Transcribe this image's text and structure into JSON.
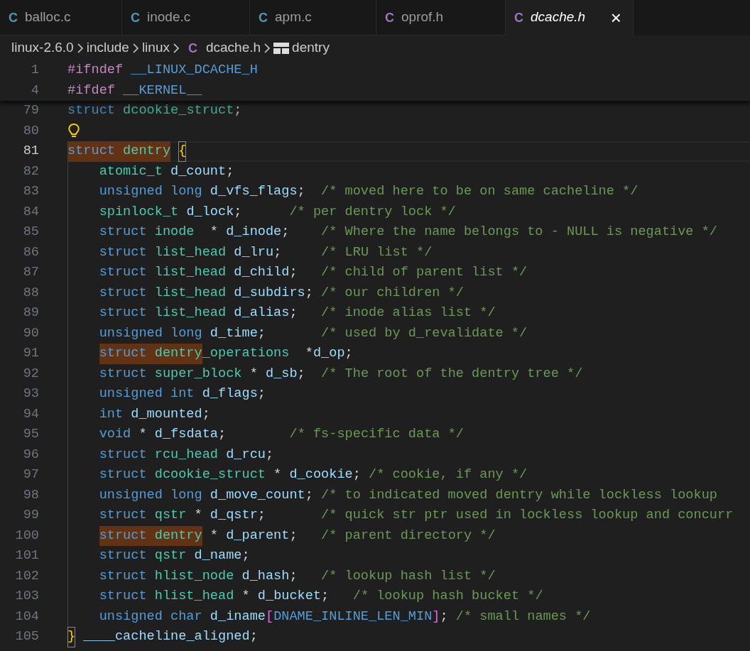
{
  "tabs": [
    {
      "icon": "C",
      "label": "balloc.c",
      "color": "#519aba",
      "selected": false,
      "preview": false
    },
    {
      "icon": "C",
      "label": "inode.c",
      "color": "#519aba",
      "selected": false,
      "preview": false
    },
    {
      "icon": "C",
      "label": "apm.c",
      "color": "#519aba",
      "selected": false,
      "preview": false
    },
    {
      "icon": "C",
      "label": "oprof.h",
      "color": "#a074c4",
      "selected": false,
      "preview": false
    },
    {
      "icon": "C",
      "label": "dcache.h",
      "color": "#a074c4",
      "selected": true,
      "preview": true
    }
  ],
  "tab_close": "×",
  "breadcrumb": [
    {
      "label": "linux-2.6.0",
      "kind": "folder"
    },
    {
      "label": "include",
      "kind": "folder"
    },
    {
      "label": "linux",
      "kind": "folder"
    },
    {
      "label": "dcache.h",
      "kind": "file",
      "icon": "C",
      "color": "#a074c4"
    },
    {
      "label": "dentry",
      "kind": "symbol"
    }
  ],
  "lines": [
    {
      "number": "1",
      "sticky": true,
      "tokens": [
        {
          "kind": "pp",
          "text": "#ifndef"
        },
        {
          "kind": "mac",
          "text": " __LINUX_DCACHE_H"
        }
      ]
    },
    {
      "number": "4",
      "sticky": true,
      "tokens": [
        {
          "kind": "pp",
          "text": "#ifdef"
        },
        {
          "kind": "mac",
          "text": " __KERNEL__"
        }
      ]
    },
    {
      "number": "79",
      "faded": true,
      "tokens": [
        {
          "kind": "kw",
          "text": "struct"
        },
        {
          "kind": "type",
          "text": " dcookie_struct"
        },
        {
          "kind": "pun",
          "text": ";"
        }
      ]
    },
    {
      "number": "80",
      "lightbulb": true
    },
    {
      "number": "81",
      "current": true,
      "tokens": [
        {
          "kind": "kw",
          "text": "struct",
          "highlight": true
        },
        {
          "kind": "type",
          "text": " dentry",
          "highlight": true
        },
        {
          "kind": "brace",
          "text": "{",
          "spaced": true
        }
      ]
    },
    {
      "number": "82",
      "indented": true,
      "tokens": [
        {
          "kind": "type",
          "text": "atomic_t"
        },
        {
          "kind": "var",
          "text": " d_count"
        },
        {
          "kind": "pun",
          "text": ";"
        }
      ]
    },
    {
      "number": "83",
      "indented": true,
      "tokens": [
        {
          "kind": "kw",
          "text": "unsigned long"
        },
        {
          "kind": "var",
          "text": " d_vfs_flags"
        },
        {
          "kind": "pun",
          "text": ";"
        },
        {
          "kind": "cm",
          "text": "  /* moved here to be on same cacheline */"
        }
      ]
    },
    {
      "number": "84",
      "indented": true,
      "tokens": [
        {
          "kind": "type",
          "text": "spinlock_t"
        },
        {
          "kind": "var",
          "text": " d_lock"
        },
        {
          "kind": "pun",
          "text": ";"
        },
        {
          "kind": "cm",
          "text": "      /* per dentry lock */"
        }
      ]
    },
    {
      "number": "85",
      "indented": true,
      "tokens": [
        {
          "kind": "kw",
          "text": "struct"
        },
        {
          "kind": "type",
          "text": " inode"
        },
        {
          "kind": "pun",
          "text": "  *"
        },
        {
          "kind": "var",
          "text": " d_inode"
        },
        {
          "kind": "pun",
          "text": ";"
        },
        {
          "kind": "cm",
          "text": "    /* Where the name belongs to - NULL is negative */"
        }
      ]
    },
    {
      "number": "86",
      "indented": true,
      "tokens": [
        {
          "kind": "kw",
          "text": "struct"
        },
        {
          "kind": "type",
          "text": " list_head"
        },
        {
          "kind": "var",
          "text": " d_lru"
        },
        {
          "kind": "pun",
          "text": ";"
        },
        {
          "kind": "cm",
          "text": "     /* LRU list */"
        }
      ]
    },
    {
      "number": "87",
      "indented": true,
      "tokens": [
        {
          "kind": "kw",
          "text": "struct"
        },
        {
          "kind": "type",
          "text": " list_head"
        },
        {
          "kind": "var",
          "text": " d_child"
        },
        {
          "kind": "pun",
          "text": ";"
        },
        {
          "kind": "cm",
          "text": "   /* child of parent list */"
        }
      ]
    },
    {
      "number": "88",
      "indented": true,
      "tokens": [
        {
          "kind": "kw",
          "text": "struct"
        },
        {
          "kind": "type",
          "text": " list_head"
        },
        {
          "kind": "var",
          "text": " d_subdirs"
        },
        {
          "kind": "pun",
          "text": ";"
        },
        {
          "kind": "cm",
          "text": " /* our children */"
        }
      ]
    },
    {
      "number": "89",
      "indented": true,
      "tokens": [
        {
          "kind": "kw",
          "text": "struct"
        },
        {
          "kind": "type",
          "text": " list_head"
        },
        {
          "kind": "var",
          "text": " d_alias"
        },
        {
          "kind": "pun",
          "text": ";"
        },
        {
          "kind": "cm",
          "text": "   /* inode alias list */"
        }
      ]
    },
    {
      "number": "90",
      "indented": true,
      "tokens": [
        {
          "kind": "kw",
          "text": "unsigned long"
        },
        {
          "kind": "var",
          "text": " d_time"
        },
        {
          "kind": "pun",
          "text": ";"
        },
        {
          "kind": "cm",
          "text": "       /* used by d_revalidate */"
        }
      ]
    },
    {
      "number": "91",
      "indented": true,
      "tokens": [
        {
          "kind": "kw",
          "text": "struct",
          "highlight": true
        },
        {
          "kind": "type",
          "text": " dentry",
          "highlight": true
        },
        {
          "kind": "type",
          "text": "_operations"
        },
        {
          "kind": "pun",
          "text": "  *"
        },
        {
          "kind": "var",
          "text": "d_op"
        },
        {
          "kind": "pun",
          "text": ";"
        }
      ]
    },
    {
      "number": "92",
      "indented": true,
      "tokens": [
        {
          "kind": "kw",
          "text": "struct"
        },
        {
          "kind": "type",
          "text": " super_block"
        },
        {
          "kind": "pun",
          "text": " *"
        },
        {
          "kind": "var",
          "text": " d_sb"
        },
        {
          "kind": "pun",
          "text": ";"
        },
        {
          "kind": "cm",
          "text": "  /* The root of the dentry tree */"
        }
      ]
    },
    {
      "number": "93",
      "indented": true,
      "tokens": [
        {
          "kind": "kw",
          "text": "unsigned int"
        },
        {
          "kind": "var",
          "text": " d_flags"
        },
        {
          "kind": "pun",
          "text": ";"
        }
      ]
    },
    {
      "number": "94",
      "indented": true,
      "tokens": [
        {
          "kind": "kw",
          "text": "int"
        },
        {
          "kind": "var",
          "text": " d_mounted"
        },
        {
          "kind": "pun",
          "text": ";"
        }
      ]
    },
    {
      "number": "95",
      "indented": true,
      "tokens": [
        {
          "kind": "kw",
          "text": "void"
        },
        {
          "kind": "pun",
          "text": " *"
        },
        {
          "kind": "var",
          "text": " d_fsdata"
        },
        {
          "kind": "pun",
          "text": ";"
        },
        {
          "kind": "cm",
          "text": "        /* fs-specific data */"
        }
      ]
    },
    {
      "number": "96",
      "indented": true,
      "tokens": [
        {
          "kind": "kw",
          "text": "struct"
        },
        {
          "kind": "type",
          "text": " rcu_head"
        },
        {
          "kind": "var",
          "text": " d_rcu"
        },
        {
          "kind": "pun",
          "text": ";"
        }
      ]
    },
    {
      "number": "97",
      "indented": true,
      "tokens": [
        {
          "kind": "kw",
          "text": "struct"
        },
        {
          "kind": "type",
          "text": " dcookie_struct"
        },
        {
          "kind": "pun",
          "text": " *"
        },
        {
          "kind": "var",
          "text": " d_cookie"
        },
        {
          "kind": "pun",
          "text": ";"
        },
        {
          "kind": "cm",
          "text": " /* cookie, if any */"
        }
      ]
    },
    {
      "number": "98",
      "indented": true,
      "tokens": [
        {
          "kind": "kw",
          "text": "unsigned long"
        },
        {
          "kind": "var",
          "text": " d_move_count"
        },
        {
          "kind": "pun",
          "text": ";"
        },
        {
          "kind": "cm",
          "text": " /* to indicated moved dentry while lockless lookup"
        }
      ]
    },
    {
      "number": "99",
      "indented": true,
      "tokens": [
        {
          "kind": "kw",
          "text": "struct"
        },
        {
          "kind": "type",
          "text": " qstr"
        },
        {
          "kind": "pun",
          "text": " *"
        },
        {
          "kind": "var",
          "text": " d_qstr"
        },
        {
          "kind": "pun",
          "text": ";"
        },
        {
          "kind": "cm",
          "text": "       /* quick str ptr used in lockless lookup and concurr"
        }
      ]
    },
    {
      "number": "100",
      "indented": true,
      "tokens": [
        {
          "kind": "kw",
          "text": "struct",
          "highlight": true
        },
        {
          "kind": "type",
          "text": " dentry",
          "highlight": true
        },
        {
          "kind": "pun",
          "text": " *"
        },
        {
          "kind": "var",
          "text": " d_parent"
        },
        {
          "kind": "pun",
          "text": ";"
        },
        {
          "kind": "cm",
          "text": "   /* parent directory */"
        }
      ]
    },
    {
      "number": "101",
      "indented": true,
      "tokens": [
        {
          "kind": "kw",
          "text": "struct"
        },
        {
          "kind": "type",
          "text": " qstr"
        },
        {
          "kind": "var",
          "text": " d_name"
        },
        {
          "kind": "pun",
          "text": ";"
        }
      ]
    },
    {
      "number": "102",
      "indented": true,
      "tokens": [
        {
          "kind": "kw",
          "text": "struct"
        },
        {
          "kind": "type",
          "text": " hlist_node"
        },
        {
          "kind": "var",
          "text": " d_hash"
        },
        {
          "kind": "pun",
          "text": ";"
        },
        {
          "kind": "cm",
          "text": "   /* lookup hash list */"
        }
      ]
    },
    {
      "number": "103",
      "indented": true,
      "tokens": [
        {
          "kind": "kw",
          "text": "struct"
        },
        {
          "kind": "type",
          "text": " hlist_head"
        },
        {
          "kind": "pun",
          "text": " *"
        },
        {
          "kind": "var",
          "text": " d_bucket"
        },
        {
          "kind": "pun",
          "text": ";"
        },
        {
          "kind": "cm",
          "text": "   /* lookup hash bucket */"
        }
      ]
    },
    {
      "number": "104",
      "indented": true,
      "tokens": [
        {
          "kind": "kw",
          "text": "unsigned char"
        },
        {
          "kind": "var",
          "text": " d_iname"
        },
        {
          "kind": "br",
          "text": "["
        },
        {
          "kind": "mac",
          "text": "DNAME_INLINE_LEN_MIN"
        },
        {
          "kind": "br",
          "text": "]"
        },
        {
          "kind": "pun",
          "text": ";"
        },
        {
          "kind": "cm",
          "text": " /* small names */"
        }
      ]
    },
    {
      "number": "105",
      "tokens": [
        {
          "kind": "brace",
          "text": "}"
        },
        {
          "kind": "var",
          "text": " ____cacheline_aligned"
        },
        {
          "kind": "pun",
          "text": ";"
        }
      ]
    }
  ]
}
